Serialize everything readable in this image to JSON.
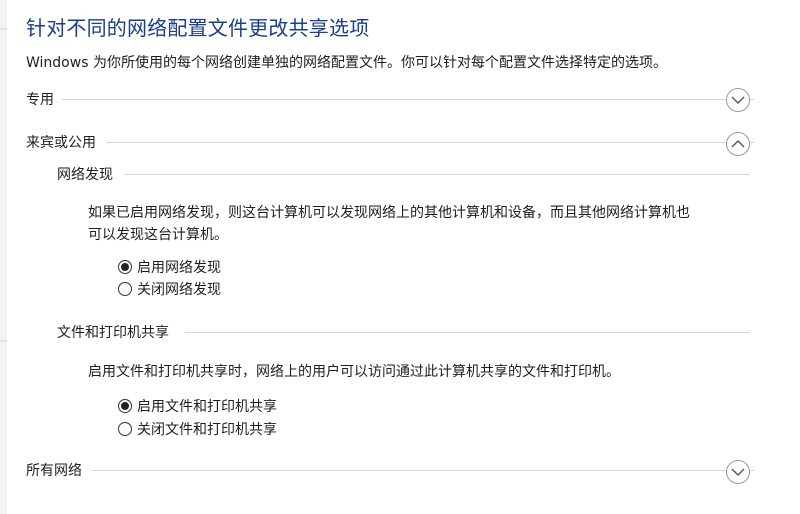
{
  "page": {
    "title": "针对不同的网络配置文件更改共享选项",
    "description": "Windows 为你所使用的每个网络创建单独的网络配置文件。你可以针对每个配置文件选择特定的选项。"
  },
  "sections": {
    "private": {
      "label": "专用",
      "expanded": false,
      "toggle_icon": "chevron-down-icon"
    },
    "guest_public": {
      "label": "来宾或公用",
      "expanded": true,
      "toggle_icon": "chevron-up-icon"
    },
    "all_networks": {
      "label": "所有网络",
      "expanded": false,
      "toggle_icon": "chevron-down-icon"
    }
  },
  "network_discovery": {
    "heading": "网络发现",
    "text_line1": "如果已启用网络发现，则这台计算机可以发现网络上的其他计算机和设备，而且其他网络计算机也",
    "text_line2": "可以发现这台计算机。",
    "options": [
      {
        "label": "启用网络发现",
        "selected": true
      },
      {
        "label": "关闭网络发现",
        "selected": false
      }
    ]
  },
  "file_printer_sharing": {
    "heading": "文件和打印机共享",
    "text": "启用文件和打印机共享时，网络上的用户可以访问通过此计算机共享的文件和打印机。",
    "options": [
      {
        "label": "启用文件和打印机共享",
        "selected": true
      },
      {
        "label": "关闭文件和打印机共享",
        "selected": false
      }
    ]
  },
  "colors": {
    "title": "#1a3e8a",
    "divider": "#d6d6d6",
    "chevron_border": "#9a9a9a"
  }
}
